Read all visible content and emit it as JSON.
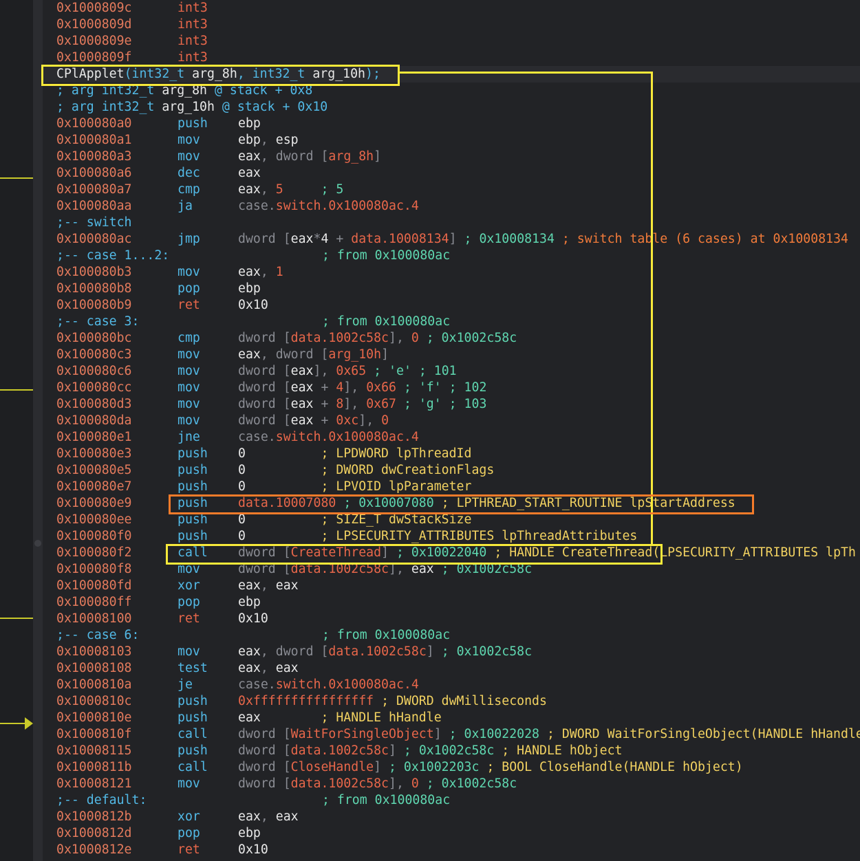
{
  "rows": [
    {
      "addr": "0x1000809c",
      "op": "int3",
      "args": ""
    },
    {
      "addr": "0x1000809d",
      "op": "int3",
      "args": ""
    },
    {
      "addr": "0x1000809e",
      "op": "int3",
      "args": ""
    },
    {
      "addr": "0x1000809f",
      "op": "int3",
      "args": ""
    },
    {
      "fn": "CPlApplet",
      "fn_sig": "(int32_t arg_8h, int32_t arg_10h);"
    },
    {
      "comment": "; arg int32_t arg_8h @ stack + 0x8"
    },
    {
      "comment": "; arg int32_t arg_10h @ stack + 0x10"
    },
    {
      "addr": "0x100080a0",
      "op": "push",
      "args": "ebp"
    },
    {
      "addr": "0x100080a1",
      "op": "mov",
      "args": "ebp, esp"
    },
    {
      "addr": "0x100080a3",
      "op": "mov",
      "args": "eax, dword [arg_8h]"
    },
    {
      "addr": "0x100080a6",
      "op": "dec",
      "args": "eax"
    },
    {
      "addr": "0x100080a7",
      "op": "cmp",
      "args": "eax, 5     ; 5"
    },
    {
      "addr": "0x100080aa",
      "op": "ja",
      "args": "case.switch.0x100080ac.4"
    },
    {
      "comment": ";-- switch"
    },
    {
      "addr": "0x100080ac",
      "op": "jmp",
      "args": "dword [eax*4 + data.10008134] ; 0x10008134 ; switch table (6 cases) at 0x10008134"
    },
    {
      "comment": ";-- case 1...2:",
      "tail": "; from 0x100080ac"
    },
    {
      "addr": "0x100080b3",
      "op": "mov",
      "args": "eax, 1"
    },
    {
      "addr": "0x100080b8",
      "op": "pop",
      "args": "ebp"
    },
    {
      "addr": "0x100080b9",
      "op": "ret",
      "args": "0x10"
    },
    {
      "comment": ";-- case 3:",
      "tail": "; from 0x100080ac"
    },
    {
      "addr": "0x100080bc",
      "op": "cmp",
      "args": "dword [data.1002c58c], 0 ; 0x1002c58c"
    },
    {
      "addr": "0x100080c3",
      "op": "mov",
      "args": "eax, dword [arg_10h]"
    },
    {
      "addr": "0x100080c6",
      "op": "mov",
      "args": "dword [eax], 0x65 ; 'e' ; 101"
    },
    {
      "addr": "0x100080cc",
      "op": "mov",
      "args": "dword [eax + 4], 0x66 ; 'f' ; 102"
    },
    {
      "addr": "0x100080d3",
      "op": "mov",
      "args": "dword [eax + 8], 0x67 ; 'g' ; 103"
    },
    {
      "addr": "0x100080da",
      "op": "mov",
      "args": "dword [eax + 0xc], 0"
    },
    {
      "addr": "0x100080e1",
      "op": "jne",
      "args": "case.switch.0x100080ac.4"
    },
    {
      "addr": "0x100080e3",
      "op": "push",
      "args": "0          ; LPDWORD lpThreadId"
    },
    {
      "addr": "0x100080e5",
      "op": "push",
      "args": "0          ; DWORD dwCreationFlags"
    },
    {
      "addr": "0x100080e7",
      "op": "push",
      "args": "0          ; LPVOID lpParameter"
    },
    {
      "addr": "0x100080e9",
      "op": "push",
      "args": "data.10007080 ; 0x10007080 ; LPTHREAD_START_ROUTINE lpStartAddress"
    },
    {
      "addr": "0x100080ee",
      "op": "push",
      "args": "0          ; SIZE_T dwStackSize"
    },
    {
      "addr": "0x100080f0",
      "op": "push",
      "args": "0          ; LPSECURITY_ATTRIBUTES lpThreadAttributes"
    },
    {
      "addr": "0x100080f2",
      "op": "call",
      "args": "dword [CreateThread] ; 0x10022040 ; HANDLE CreateThread(LPSECURITY_ATTRIBUTES lpTh"
    },
    {
      "addr": "0x100080f8",
      "op": "mov",
      "args": "dword [data.1002c58c], eax ; 0x1002c58c"
    },
    {
      "addr": "0x100080fd",
      "op": "xor",
      "args": "eax, eax"
    },
    {
      "addr": "0x100080ff",
      "op": "pop",
      "args": "ebp"
    },
    {
      "addr": "0x10008100",
      "op": "ret",
      "args": "0x10"
    },
    {
      "comment": ";-- case 6:",
      "tail": "; from 0x100080ac"
    },
    {
      "addr": "0x10008103",
      "op": "mov",
      "args": "eax, dword [data.1002c58c] ; 0x1002c58c"
    },
    {
      "addr": "0x10008108",
      "op": "test",
      "args": "eax, eax"
    },
    {
      "addr": "0x1000810a",
      "op": "je",
      "args": "case.switch.0x100080ac.4"
    },
    {
      "addr": "0x1000810c",
      "op": "push",
      "args": "0xffffffffffffffff ; DWORD dwMilliseconds"
    },
    {
      "addr": "0x1000810e",
      "op": "push",
      "args": "eax        ; HANDLE hHandle"
    },
    {
      "addr": "0x1000810f",
      "op": "call",
      "args": "dword [WaitForSingleObject] ; 0x10022028 ; DWORD WaitForSingleObject(HANDLE hHandle"
    },
    {
      "addr": "0x10008115",
      "op": "push",
      "args": "dword [data.1002c58c] ; 0x1002c58c ; HANDLE hObject"
    },
    {
      "addr": "0x1000811b",
      "op": "call",
      "args": "dword [CloseHandle] ; 0x1002203c ; BOOL CloseHandle(HANDLE hObject)"
    },
    {
      "addr": "0x10008121",
      "op": "mov",
      "args": "dword [data.1002c58c], 0 ; 0x1002c58c"
    },
    {
      "comment": ";-- default:",
      "tail": "; from 0x100080ac"
    },
    {
      "addr": "0x1000812b",
      "op": "xor",
      "args": "eax, eax"
    },
    {
      "addr": "0x1000812d",
      "op": "pop",
      "args": "ebp"
    },
    {
      "addr": "0x1000812e",
      "op": "ret",
      "args": "0x10"
    }
  ],
  "colors": {
    "address": "#e37a5c",
    "mnemonic": "#52b9e6",
    "highlight_yellow": "#f7e93a",
    "highlight_orange": "#f47b2a",
    "background": "#222326"
  }
}
